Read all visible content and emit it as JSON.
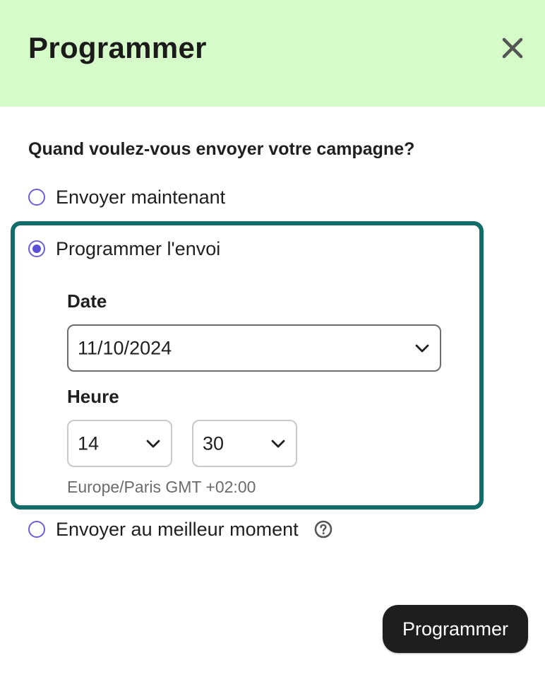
{
  "header": {
    "title": "Programmer",
    "close_icon": "close-icon",
    "background": "#d5fbc8"
  },
  "question": "Quand voulez-vous envoyer votre campagne?",
  "options": [
    {
      "label": "Envoyer maintenant",
      "selected": false
    },
    {
      "label": "Programmer l'envoi",
      "selected": true
    },
    {
      "label": "Envoyer au meilleur moment",
      "selected": false,
      "help_icon": "help-circle-icon"
    }
  ],
  "schedule": {
    "date_label": "Date",
    "date_value": "11/10/2024",
    "time_label": "Heure",
    "hour_value": "14",
    "minute_value": "30",
    "timezone": "Europe/Paris GMT +02:00"
  },
  "footer": {
    "submit_label": "Programmer"
  },
  "colors": {
    "accent": "#5b4fd6",
    "focus_border": "#126d6a",
    "button_bg": "#1e1e1e"
  }
}
